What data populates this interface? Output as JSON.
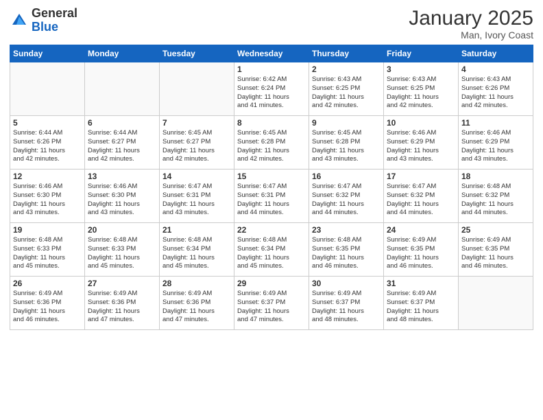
{
  "header": {
    "logo_general": "General",
    "logo_blue": "Blue",
    "month_title": "January 2025",
    "location": "Man, Ivory Coast"
  },
  "weekdays": [
    "Sunday",
    "Monday",
    "Tuesday",
    "Wednesday",
    "Thursday",
    "Friday",
    "Saturday"
  ],
  "weeks": [
    [
      {
        "day": "",
        "info": ""
      },
      {
        "day": "",
        "info": ""
      },
      {
        "day": "",
        "info": ""
      },
      {
        "day": "1",
        "info": "Sunrise: 6:42 AM\nSunset: 6:24 PM\nDaylight: 11 hours\nand 41 minutes."
      },
      {
        "day": "2",
        "info": "Sunrise: 6:43 AM\nSunset: 6:25 PM\nDaylight: 11 hours\nand 42 minutes."
      },
      {
        "day": "3",
        "info": "Sunrise: 6:43 AM\nSunset: 6:25 PM\nDaylight: 11 hours\nand 42 minutes."
      },
      {
        "day": "4",
        "info": "Sunrise: 6:43 AM\nSunset: 6:26 PM\nDaylight: 11 hours\nand 42 minutes."
      }
    ],
    [
      {
        "day": "5",
        "info": "Sunrise: 6:44 AM\nSunset: 6:26 PM\nDaylight: 11 hours\nand 42 minutes."
      },
      {
        "day": "6",
        "info": "Sunrise: 6:44 AM\nSunset: 6:27 PM\nDaylight: 11 hours\nand 42 minutes."
      },
      {
        "day": "7",
        "info": "Sunrise: 6:45 AM\nSunset: 6:27 PM\nDaylight: 11 hours\nand 42 minutes."
      },
      {
        "day": "8",
        "info": "Sunrise: 6:45 AM\nSunset: 6:28 PM\nDaylight: 11 hours\nand 42 minutes."
      },
      {
        "day": "9",
        "info": "Sunrise: 6:45 AM\nSunset: 6:28 PM\nDaylight: 11 hours\nand 43 minutes."
      },
      {
        "day": "10",
        "info": "Sunrise: 6:46 AM\nSunset: 6:29 PM\nDaylight: 11 hours\nand 43 minutes."
      },
      {
        "day": "11",
        "info": "Sunrise: 6:46 AM\nSunset: 6:29 PM\nDaylight: 11 hours\nand 43 minutes."
      }
    ],
    [
      {
        "day": "12",
        "info": "Sunrise: 6:46 AM\nSunset: 6:30 PM\nDaylight: 11 hours\nand 43 minutes."
      },
      {
        "day": "13",
        "info": "Sunrise: 6:46 AM\nSunset: 6:30 PM\nDaylight: 11 hours\nand 43 minutes."
      },
      {
        "day": "14",
        "info": "Sunrise: 6:47 AM\nSunset: 6:31 PM\nDaylight: 11 hours\nand 43 minutes."
      },
      {
        "day": "15",
        "info": "Sunrise: 6:47 AM\nSunset: 6:31 PM\nDaylight: 11 hours\nand 44 minutes."
      },
      {
        "day": "16",
        "info": "Sunrise: 6:47 AM\nSunset: 6:32 PM\nDaylight: 11 hours\nand 44 minutes."
      },
      {
        "day": "17",
        "info": "Sunrise: 6:47 AM\nSunset: 6:32 PM\nDaylight: 11 hours\nand 44 minutes."
      },
      {
        "day": "18",
        "info": "Sunrise: 6:48 AM\nSunset: 6:32 PM\nDaylight: 11 hours\nand 44 minutes."
      }
    ],
    [
      {
        "day": "19",
        "info": "Sunrise: 6:48 AM\nSunset: 6:33 PM\nDaylight: 11 hours\nand 45 minutes."
      },
      {
        "day": "20",
        "info": "Sunrise: 6:48 AM\nSunset: 6:33 PM\nDaylight: 11 hours\nand 45 minutes."
      },
      {
        "day": "21",
        "info": "Sunrise: 6:48 AM\nSunset: 6:34 PM\nDaylight: 11 hours\nand 45 minutes."
      },
      {
        "day": "22",
        "info": "Sunrise: 6:48 AM\nSunset: 6:34 PM\nDaylight: 11 hours\nand 45 minutes."
      },
      {
        "day": "23",
        "info": "Sunrise: 6:48 AM\nSunset: 6:35 PM\nDaylight: 11 hours\nand 46 minutes."
      },
      {
        "day": "24",
        "info": "Sunrise: 6:49 AM\nSunset: 6:35 PM\nDaylight: 11 hours\nand 46 minutes."
      },
      {
        "day": "25",
        "info": "Sunrise: 6:49 AM\nSunset: 6:35 PM\nDaylight: 11 hours\nand 46 minutes."
      }
    ],
    [
      {
        "day": "26",
        "info": "Sunrise: 6:49 AM\nSunset: 6:36 PM\nDaylight: 11 hours\nand 46 minutes."
      },
      {
        "day": "27",
        "info": "Sunrise: 6:49 AM\nSunset: 6:36 PM\nDaylight: 11 hours\nand 47 minutes."
      },
      {
        "day": "28",
        "info": "Sunrise: 6:49 AM\nSunset: 6:36 PM\nDaylight: 11 hours\nand 47 minutes."
      },
      {
        "day": "29",
        "info": "Sunrise: 6:49 AM\nSunset: 6:37 PM\nDaylight: 11 hours\nand 47 minutes."
      },
      {
        "day": "30",
        "info": "Sunrise: 6:49 AM\nSunset: 6:37 PM\nDaylight: 11 hours\nand 48 minutes."
      },
      {
        "day": "31",
        "info": "Sunrise: 6:49 AM\nSunset: 6:37 PM\nDaylight: 11 hours\nand 48 minutes."
      },
      {
        "day": "",
        "info": ""
      }
    ]
  ]
}
